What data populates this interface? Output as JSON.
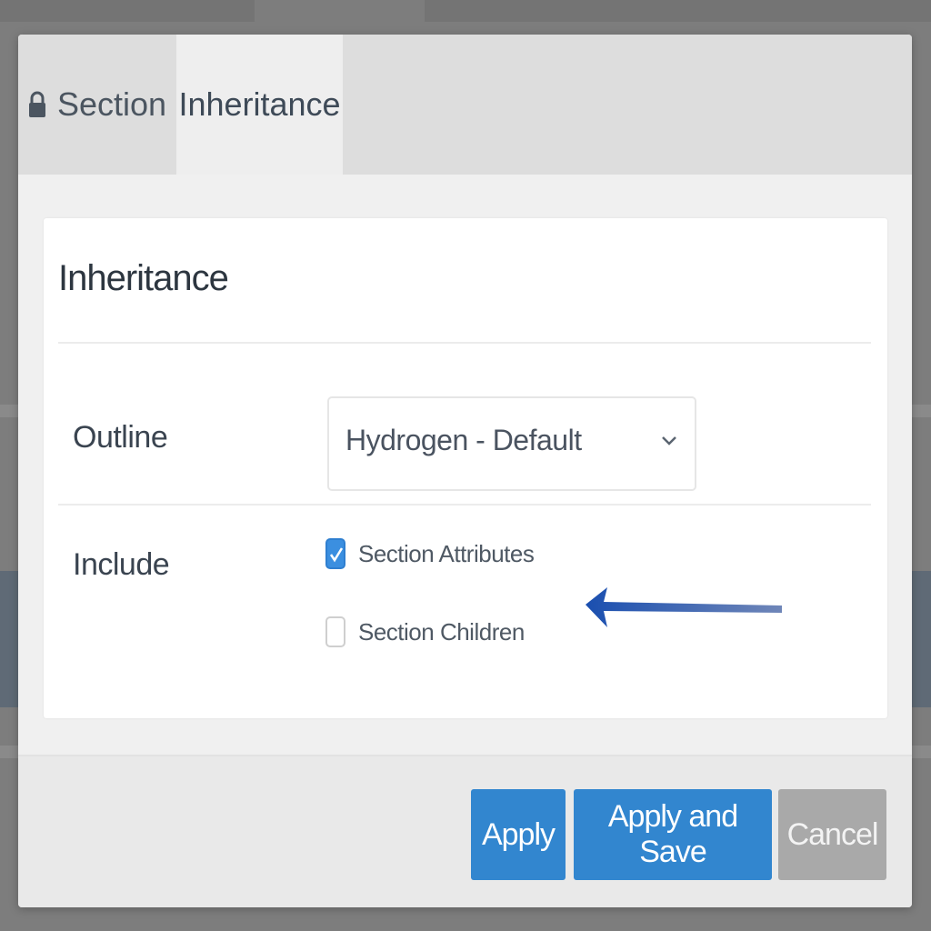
{
  "tabs": [
    {
      "label": "Section",
      "icon": "lock-icon"
    },
    {
      "label": "Inheritance",
      "active": true
    }
  ],
  "card": {
    "title": "Inheritance",
    "outline_label": "Outline",
    "outline_value": "Hydrogen - Default",
    "include_label": "Include",
    "options": [
      {
        "label": "Section Attributes",
        "checked": true
      },
      {
        "label": "Section Children",
        "checked": false
      }
    ]
  },
  "annotation": {
    "icon": "arrow-left-icon",
    "color": "#1a55b5"
  },
  "footer": {
    "apply_label": "Apply",
    "apply_save_label": "Apply and Save",
    "cancel_label": "Cancel"
  },
  "colors": {
    "primary": "#3286cf",
    "cancel": "#a9a9a9",
    "checkbox_checked": "#3b8fe0"
  }
}
